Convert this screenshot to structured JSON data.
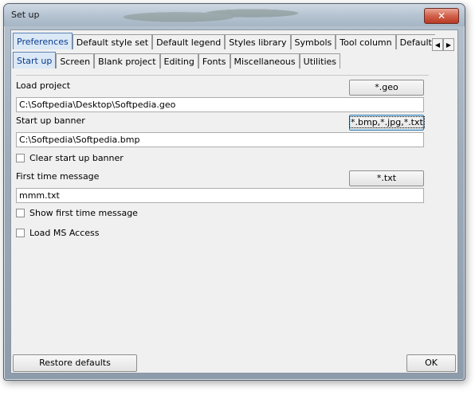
{
  "window": {
    "title": "Set up",
    "close_glyph": "✕"
  },
  "tabs_main": [
    "Preferences",
    "Default style set",
    "Default legend",
    "Styles library",
    "Symbols",
    "Tool column",
    "Default proje"
  ],
  "tab_scroll": {
    "left": "◀",
    "right": "▶"
  },
  "tabs_sub": [
    "Start up",
    "Screen",
    "Blank project",
    "Editing",
    "Fonts",
    "Miscellaneous",
    "Utilities"
  ],
  "startup": {
    "load_project_label": "Load project",
    "load_project_button": "*.geo",
    "load_project_value": "C:\\Softpedia\\Desktop\\Softpedia.geo",
    "banner_label": "Start up banner",
    "banner_button": "*.bmp,*.jpg,*.txt",
    "banner_value": "C:\\Softpedia\\Softpedia.bmp",
    "clear_banner_label": "Clear start up banner",
    "first_message_label": "First time message",
    "first_message_button": "*.txt",
    "first_message_value": "mmm.txt",
    "show_first_message_label": "Show first time message",
    "load_ms_access_label": "Load MS Access"
  },
  "footer": {
    "restore_label": "Restore defaults",
    "ok_label": "OK"
  }
}
